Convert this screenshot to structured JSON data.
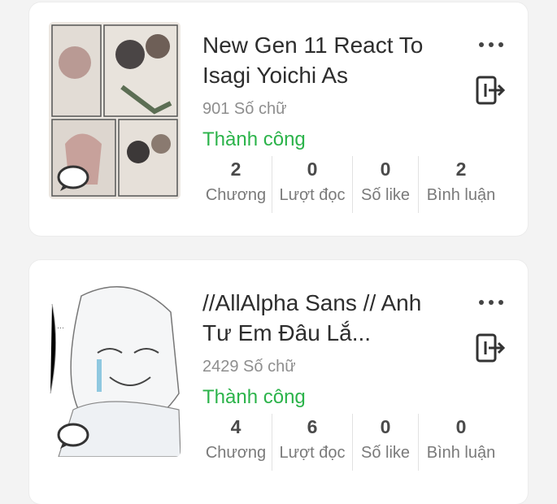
{
  "stories": [
    {
      "title": "New Gen 11 React To Isagi Yoichi As",
      "word_count": "901 Số chữ",
      "status": "Thành công",
      "stats": [
        {
          "value": "2",
          "label": "Chương"
        },
        {
          "value": "0",
          "label": "Lượt đọc"
        },
        {
          "value": "0",
          "label": "Số like"
        },
        {
          "value": "2",
          "label": "Bình luận"
        }
      ]
    },
    {
      "title": "//AllAlpha Sans // Anh Tư Em Đâu Lắ...",
      "word_count": "2429 Số chữ",
      "status": "Thành công",
      "stats": [
        {
          "value": "4",
          "label": "Chương"
        },
        {
          "value": "6",
          "label": "Lượt đọc"
        },
        {
          "value": "0",
          "label": "Số like"
        },
        {
          "value": "0",
          "label": "Bình luận"
        }
      ]
    }
  ],
  "colors": {
    "status": "#2bb34a",
    "title": "#2d2d2d",
    "muted": "#8e8e8e"
  },
  "icons": [
    "more-dots-icon",
    "exit-icon",
    "comment-bubble-icon"
  ]
}
